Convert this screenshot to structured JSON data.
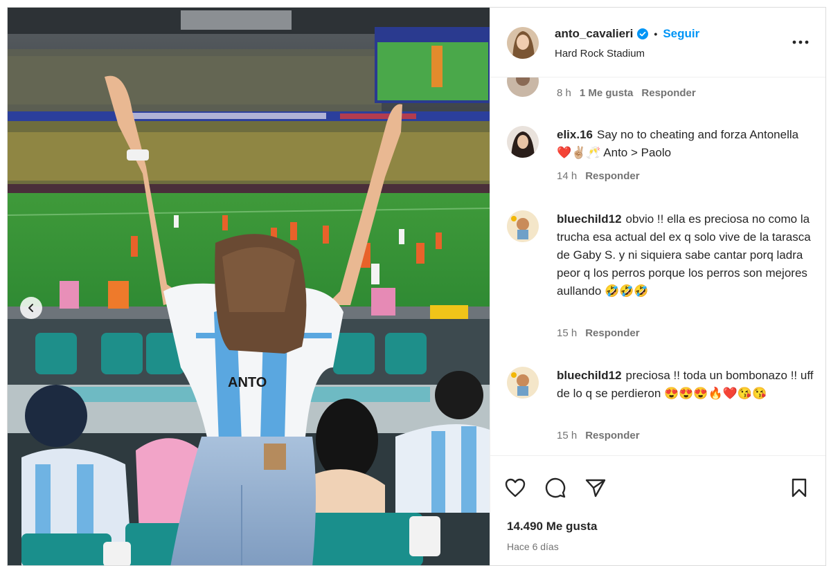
{
  "post": {
    "username": "anto_cavalieri",
    "follow_label": "Seguir",
    "location": "Hard Rock Stadium",
    "photo_jersey_text": "ANTO",
    "likes": "14.490 Me gusta",
    "date": "Hace 6 días"
  },
  "icons": [
    "chevron-left-icon",
    "verified-badge-icon",
    "more-options-icon",
    "heart-icon",
    "comment-icon",
    "share-icon",
    "bookmark-icon"
  ],
  "comments": [
    {
      "time": "8 h",
      "likes": "1 Me gusta",
      "reply": "Responder"
    },
    {
      "user": "elix.16",
      "text": "Say no to cheating and forza Antonella ❤️✌🏼🥂 Anto > Paolo",
      "time": "14 h",
      "reply": "Responder"
    },
    {
      "user": "bluechild12",
      "text": "obvio !! ella es preciosa no como la trucha esa actual del ex q solo vive de la tarasca de Gaby S. y ni siquiera sabe cantar porq ladra peor q los perros porque los perros son mejores aullando 🤣🤣🤣",
      "time": "15 h",
      "reply": "Responder"
    },
    {
      "user": "bluechild12",
      "text": "preciosa !! toda un bombonazo !! uff de lo q se perdieron 😍😍😍🔥❤️😘😘",
      "time": "15 h",
      "reply": "Responder"
    }
  ],
  "colors": {
    "link": "#0095f6",
    "text": "#262626",
    "secondary": "#737373",
    "border": "#dbdbdb"
  }
}
